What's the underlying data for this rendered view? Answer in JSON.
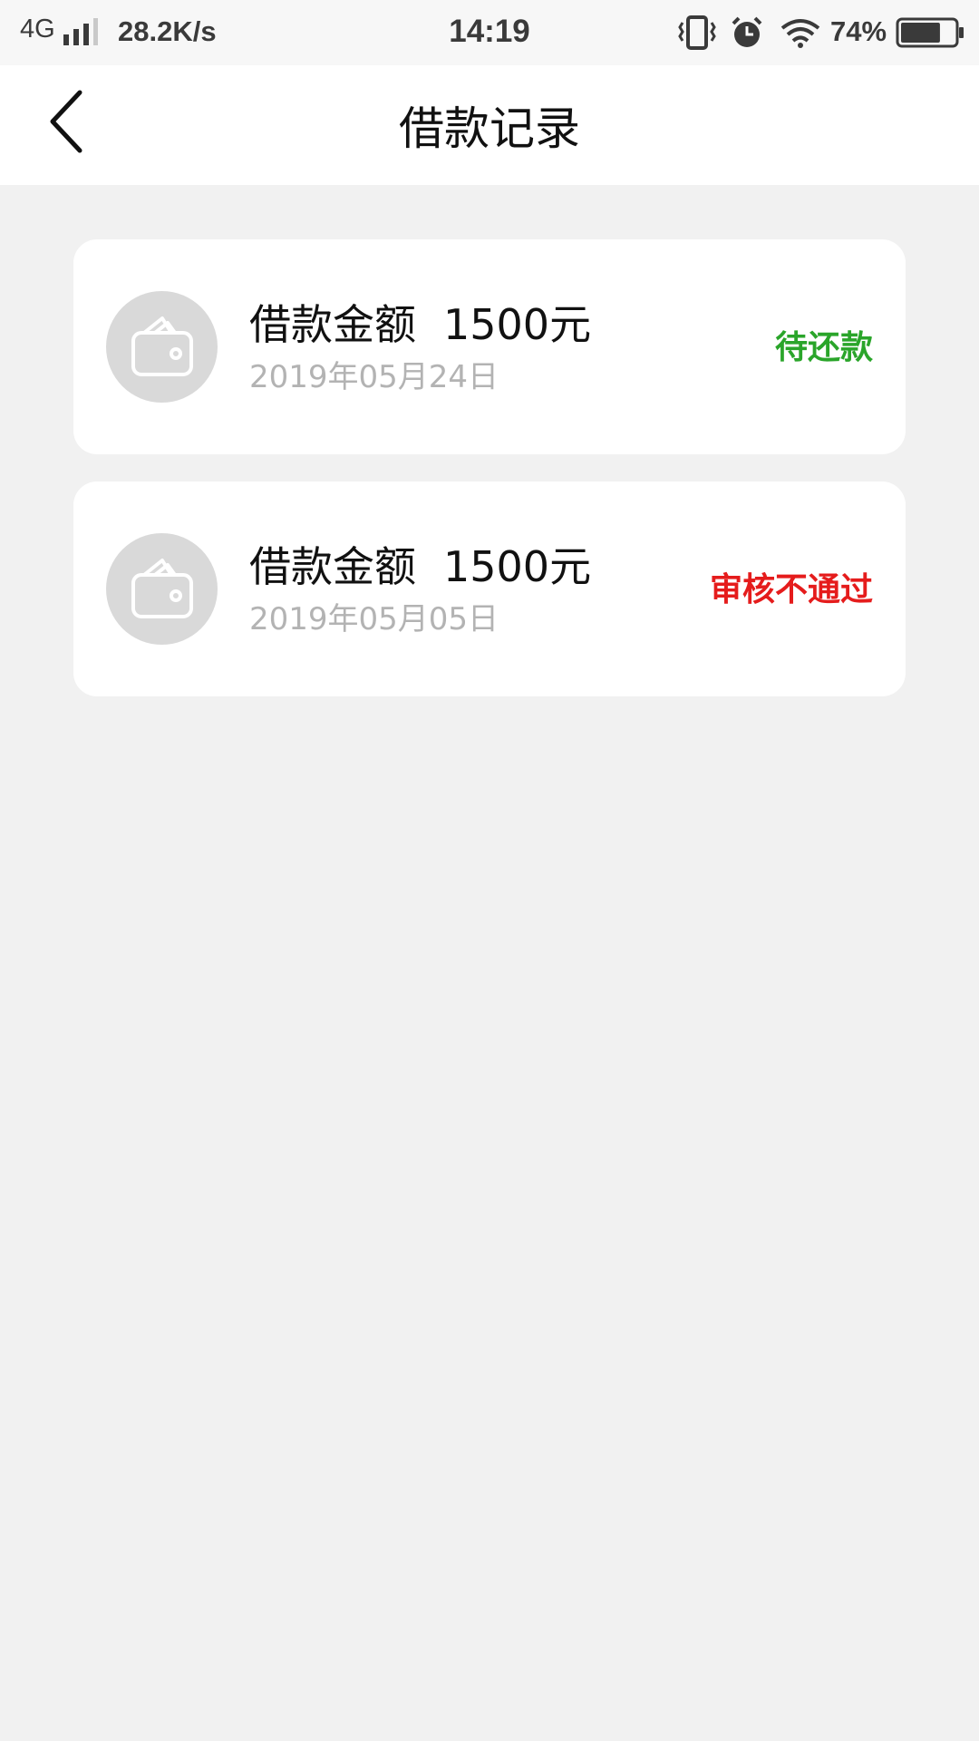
{
  "status_bar": {
    "network": "4G",
    "speed": "28.2K/s",
    "time": "14:19",
    "battery": "74%",
    "battery_level": 0.74
  },
  "header": {
    "title": "借款记录",
    "back_icon": "chevron-left-icon"
  },
  "records": [
    {
      "label": "借款金额",
      "amount": "1500元",
      "date": "2019年05月24日",
      "status": "待还款",
      "status_color": "#2aa52a",
      "icon": "wallet-icon"
    },
    {
      "label": "借款金额",
      "amount": "1500元",
      "date": "2019年05月05日",
      "status": "审核不通过",
      "status_color": "#e51c1c",
      "icon": "wallet-icon"
    }
  ],
  "colors": {
    "background": "#f1f1f1",
    "card": "#ffffff",
    "icon_circle": "#d9d9d9",
    "date_text": "#b3b3b3"
  }
}
